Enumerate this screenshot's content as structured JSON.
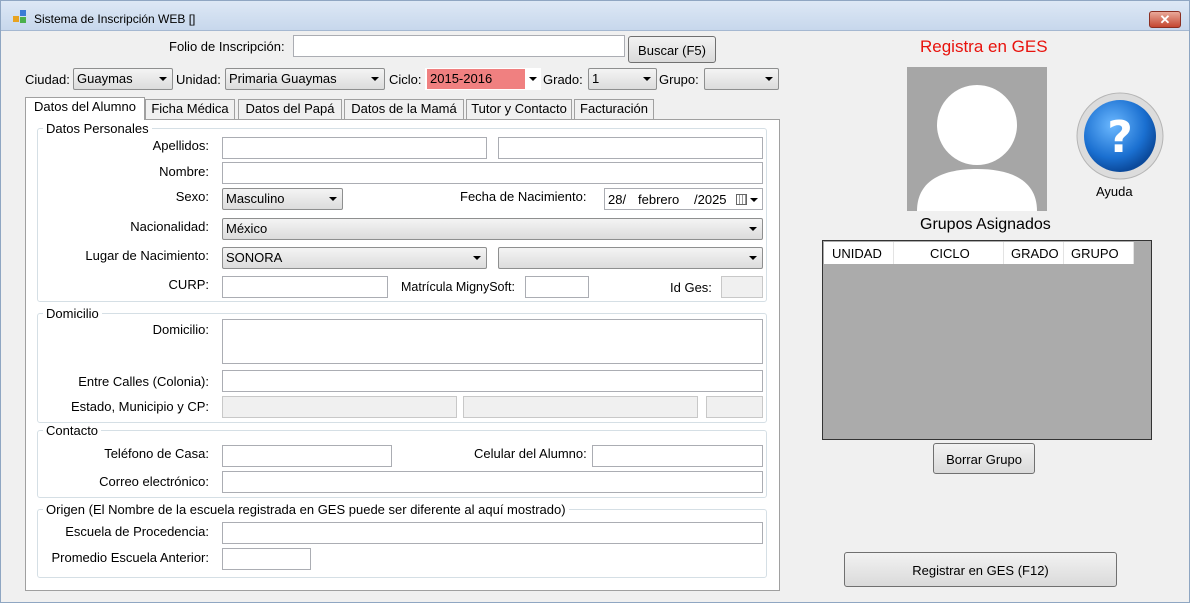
{
  "window": {
    "title": "Sistema de Inscripción WEB []",
    "close_label": "✕"
  },
  "header": {
    "folio_label": "Folio de Inscripción:",
    "folio_value": "",
    "buscar_label": "Buscar (F5)",
    "ciudad_label": "Ciudad:",
    "ciudad_value": "Guaymas",
    "unidad_label": "Unidad:",
    "unidad_value": "Primaria Guaymas",
    "ciclo_label": "Ciclo:",
    "ciclo_value": "2015-2016",
    "grado_label": "Grado:",
    "grado_value": "1",
    "grupo_label": "Grupo:",
    "grupo_value": ""
  },
  "tabs": [
    "Datos del Alumno",
    "Ficha Médica",
    "Datos del Papá",
    "Datos de la Mamá",
    "Tutor y Contacto",
    "Facturación"
  ],
  "personal": {
    "title": "Datos Personales",
    "apellidos_label": "Apellidos:",
    "nombre_label": "Nombre:",
    "sexo_label": "Sexo:",
    "sexo_value": "Masculino",
    "fecha_label": "Fecha de Nacimiento:",
    "fecha_day": "28/",
    "fecha_month": "febrero",
    "fecha_year": "/2025",
    "nacionalidad_label": "Nacionalidad:",
    "nacionalidad_value": "México",
    "lugar_label": "Lugar de Nacimiento:",
    "lugar_value": "SONORA",
    "lugar_value2": "",
    "curp_label": "CURP:",
    "matricula_label": "Matrícula MignySoft:",
    "idges_label": "Id Ges:"
  },
  "domicilio": {
    "title": "Domicilio",
    "domicilio_label": "Domicilio:",
    "entre_label": "Entre Calles (Colonia):",
    "estado_label": "Estado, Municipio y CP:"
  },
  "contacto": {
    "title": "Contacto",
    "telefono_label": "Teléfono de Casa:",
    "celular_label": "Celular del Alumno:",
    "correo_label": "Correo electrónico:"
  },
  "origen": {
    "title": "Origen (El Nombre de la escuela registrada en GES puede ser diferente al aquí mostrado)",
    "escuela_label": "Escuela de Procedencia:",
    "promedio_label": "Promedio Escuela Anterior:"
  },
  "right": {
    "registra_label": "Registra en GES",
    "ayuda_label": "Ayuda",
    "grupos_label": "Grupos Asignados",
    "grid_columns": [
      "UNIDAD",
      "CICLO",
      "GRADO",
      "GRUPO"
    ],
    "borrar_label": "Borrar Grupo",
    "registrar_label": "Registrar en GES (F12)"
  },
  "colors": {
    "ciclo_bg": "#f08080",
    "registra_text": "#e8120c",
    "help_blue": "#1a6fd0"
  }
}
